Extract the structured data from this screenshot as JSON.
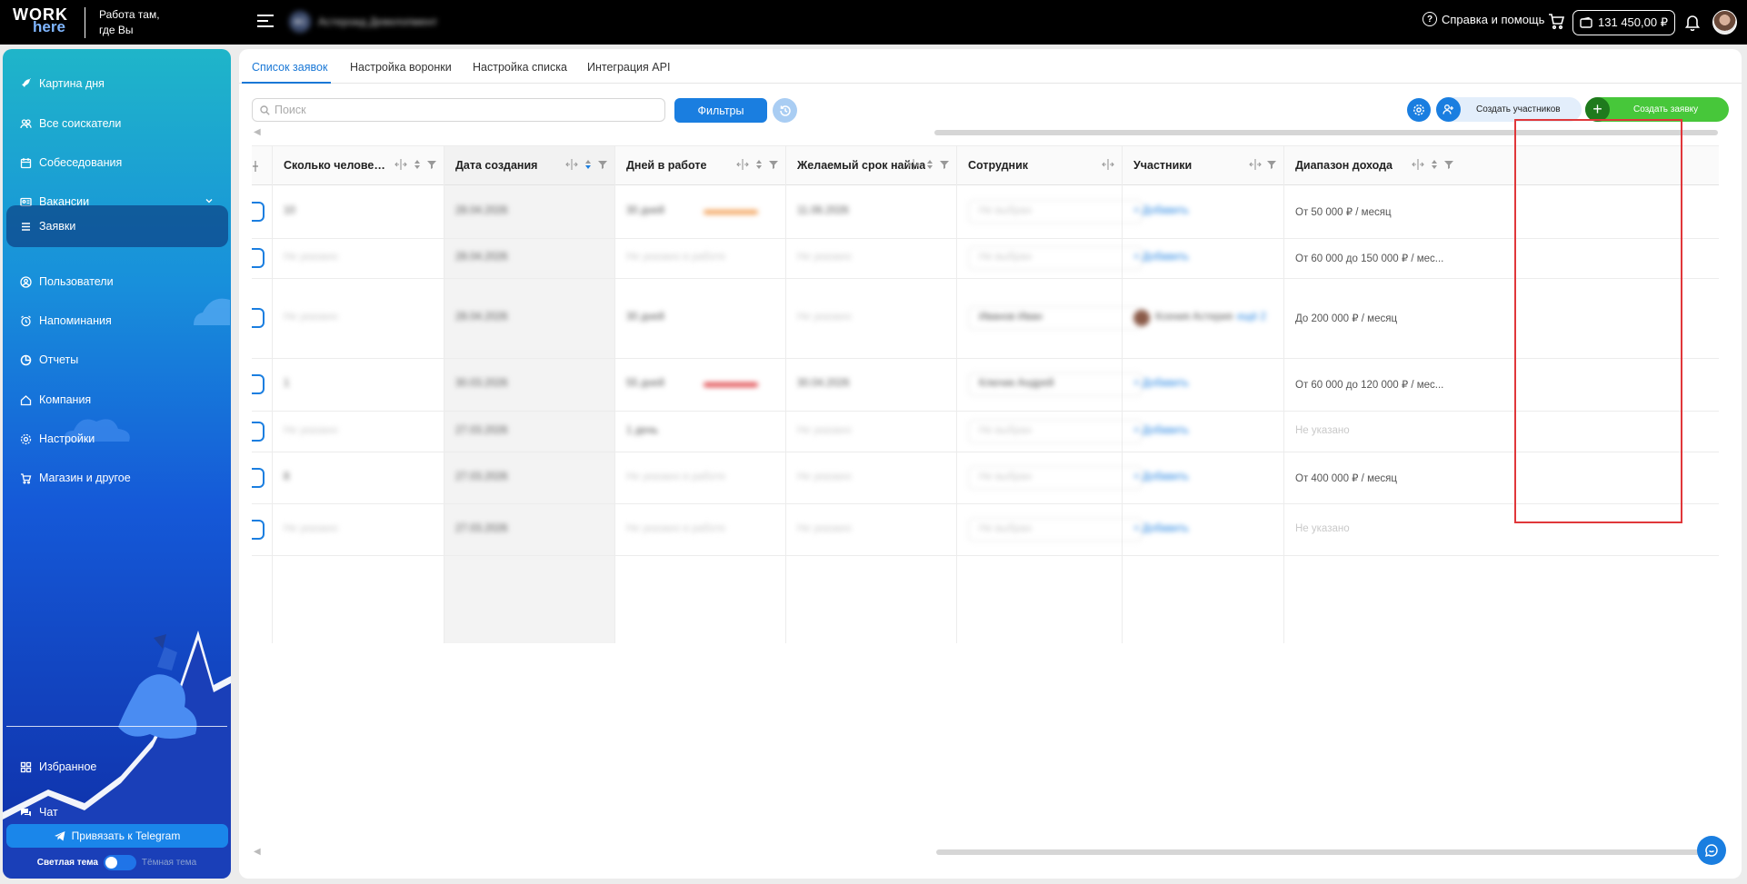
{
  "app": {
    "logo_top": "WORK",
    "logo_bottom": "here",
    "slogan_line1": "Работа там,",
    "slogan_line2": "где Вы",
    "company_initials": "ФС",
    "company_name": "Астероид Девелопмент"
  },
  "topbar": {
    "help_label": "Справка и помощь",
    "balance": "131 450,00 ₽"
  },
  "sidebar": {
    "items": [
      {
        "label": "Картина дня",
        "icon": "rocket-icon"
      },
      {
        "label": "Все соискатели",
        "icon": "people-icon"
      },
      {
        "label": "Собеседования",
        "icon": "calendar-icon"
      },
      {
        "label": "Вакансии",
        "icon": "vacancy-icon"
      },
      {
        "label": "Заявки",
        "icon": "list-icon"
      },
      {
        "label": "Пользователи",
        "icon": "user-circle-icon"
      },
      {
        "label": "Напоминания",
        "icon": "alarm-icon"
      },
      {
        "label": "Отчеты",
        "icon": "pie-chart-icon"
      },
      {
        "label": "Компания",
        "icon": "home-icon"
      },
      {
        "label": "Настройки",
        "icon": "gear-icon"
      },
      {
        "label": "Магазин и другое",
        "icon": "cart-icon"
      }
    ],
    "active_index": 4,
    "bottom_items": [
      {
        "label": "Избранное",
        "icon": "grid-icon"
      },
      {
        "label": "Чат",
        "icon": "chat-icon"
      }
    ],
    "telegram_button": "Привязать к Telegram",
    "theme_light": "Светлая тема",
    "theme_dark": "Тёмная тема"
  },
  "tabs": [
    "Список заявок",
    "Настройка воронки",
    "Настройка списка",
    "Интеграция API"
  ],
  "active_tab": 0,
  "toolbar": {
    "search_placeholder": "Поиск",
    "filters_label": "Фильтры",
    "create_participants_label": "Создать участников",
    "create_request_label": "Создать заявку"
  },
  "table": {
    "columns": [
      "Сколько человек нужно…",
      "Дата создания",
      "Дней в работе",
      "Желаемый срок найма",
      "Сотрудник",
      "Участники",
      "Диапазон дохода"
    ],
    "rows": [
      {
        "people": "10",
        "created": "28.04.2026",
        "days": "30 дней",
        "days_bar": "orange",
        "deadline": "11.06.2026",
        "employee": "Не выбран",
        "participants": "+ Добавить",
        "income": "От 50 000 ₽ / месяц"
      },
      {
        "people": "Не указано",
        "created": "28.04.2026",
        "days": "Не указано в работе",
        "days_bar": "",
        "deadline": "Не указано",
        "employee": "Не выбран",
        "participants": "+ Добавить",
        "income": "От 60 000 до 150 000 ₽ / мес..."
      },
      {
        "people": "Не указано",
        "created": "28.04.2026",
        "days": "30 дней",
        "days_bar": "",
        "deadline": "Не указано",
        "employee": "Иванов Иван",
        "participants": "Ксения Астерия",
        "participants_more": "ещё 2",
        "income": "До 200 000 ₽ / месяц"
      },
      {
        "people": "1",
        "created": "30.03.2026",
        "days": "55 дней",
        "days_bar": "red",
        "deadline": "30.04.2026",
        "employee": "Ключик Андрей",
        "participants": "+ Добавить",
        "income": "От 60 000 до 120 000 ₽ / мес..."
      },
      {
        "people": "Не указано",
        "created": "27.03.2026",
        "days": "1 день",
        "days_bar": "",
        "deadline": "Не указано",
        "employee": "Не выбран",
        "participants": "+ Добавить",
        "income": "Не указано"
      },
      {
        "people": "8",
        "created": "27.03.2026",
        "days": "Не указано в работе",
        "days_bar": "",
        "deadline": "Не указано",
        "employee": "Не выбран",
        "participants": "+ Добавить",
        "income": "От 400 000 ₽ / месяц"
      },
      {
        "people": "Не указано",
        "created": "27.03.2026",
        "days": "Не указано в работе",
        "days_bar": "",
        "deadline": "Не указано",
        "employee": "Не выбран",
        "participants": "+ Добавить",
        "income": "Не указано"
      }
    ]
  },
  "colors": {
    "accent": "#1a7ee0",
    "green": "#47c73a",
    "highlight": "#e0373a",
    "bar_orange": "#f2a25a",
    "bar_red": "#e0484c"
  }
}
